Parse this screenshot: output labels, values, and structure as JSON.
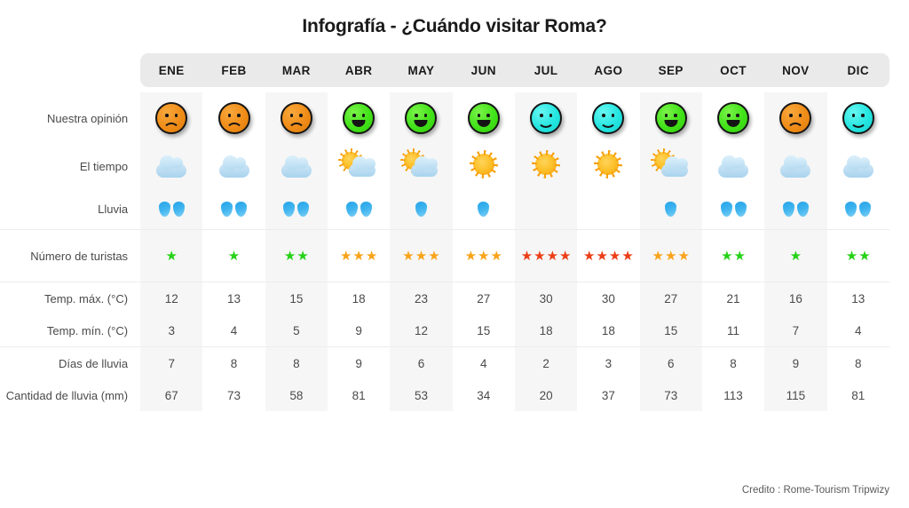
{
  "title": "Infografía - ¿Cuándo visitar Roma?",
  "credit": "Credito : Rome-Tourism Tripwizy",
  "colors": {
    "header_bg": "#eaeaea",
    "column_shade": "#f6f6f6",
    "star_green": "#25d216",
    "star_orange": "#f9a319",
    "star_red": "#ec3e16",
    "face_orange": "#f08c18",
    "face_green": "#41e218",
    "face_cyan": "#24e5e0",
    "drop_blue": "#3fb4ef",
    "sun_yellow": "#fcc02a",
    "cloud_blue": "#b4daf1"
  },
  "months": [
    "ENE",
    "FEB",
    "MAR",
    "ABR",
    "MAY",
    "JUN",
    "JUL",
    "AGO",
    "SEP",
    "OCT",
    "NOV",
    "DIC"
  ],
  "row_labels": {
    "opinion": "Nuestra opinión",
    "weather": "El tiempo",
    "rain": "Lluvia",
    "tourists": "Número de turistas",
    "tmax": "Temp. máx. (°C)",
    "tmin": "Temp. mín. (°C)",
    "raindays": "Días de lluvia",
    "rainamount": "Cantidad de lluvia (mm)"
  },
  "chart_data": {
    "type": "table",
    "title": "Infografía - ¿Cuándo visitar Roma?",
    "categories": [
      "ENE",
      "FEB",
      "MAR",
      "ABR",
      "MAY",
      "JUN",
      "JUL",
      "AGO",
      "SEP",
      "OCT",
      "NOV",
      "DIC"
    ],
    "series": [
      {
        "name": "Nuestra opinión",
        "icon": "smiley-face",
        "values": [
          "sad-orange",
          "sad-orange",
          "sad-orange",
          "happy-green",
          "happy-green",
          "happy-green",
          "smile-cyan",
          "smile-cyan",
          "happy-green",
          "happy-green",
          "sad-orange",
          "smile-cyan"
        ]
      },
      {
        "name": "El tiempo",
        "icon": "weather",
        "values": [
          "cloudy",
          "cloudy",
          "cloudy",
          "partly-sunny",
          "partly-sunny",
          "sunny",
          "sunny",
          "sunny",
          "partly-sunny",
          "cloudy",
          "cloudy",
          "cloudy"
        ]
      },
      {
        "name": "Lluvia",
        "icon": "raindrop",
        "values": [
          2,
          2,
          2,
          2,
          1,
          1,
          0,
          0,
          1,
          2,
          2,
          2
        ]
      },
      {
        "name": "Número de turistas",
        "icon": "star",
        "values": [
          1,
          1,
          2,
          3,
          3,
          3,
          4,
          4,
          3,
          2,
          1,
          2
        ],
        "colors": [
          "green",
          "green",
          "green",
          "orange",
          "orange",
          "orange",
          "red",
          "red",
          "orange",
          "green",
          "green",
          "green"
        ]
      },
      {
        "name": "Temp. máx. (°C)",
        "values": [
          12,
          13,
          15,
          18,
          23,
          27,
          30,
          30,
          27,
          21,
          16,
          13
        ]
      },
      {
        "name": "Temp. mín. (°C)",
        "values": [
          3,
          4,
          5,
          9,
          12,
          15,
          18,
          18,
          15,
          11,
          7,
          4
        ]
      },
      {
        "name": "Días de lluvia",
        "values": [
          7,
          8,
          8,
          9,
          6,
          4,
          2,
          3,
          6,
          8,
          9,
          8
        ]
      },
      {
        "name": "Cantidad de lluvia (mm)",
        "values": [
          67,
          73,
          58,
          81,
          53,
          34,
          20,
          37,
          73,
          113,
          115,
          81
        ]
      }
    ]
  }
}
